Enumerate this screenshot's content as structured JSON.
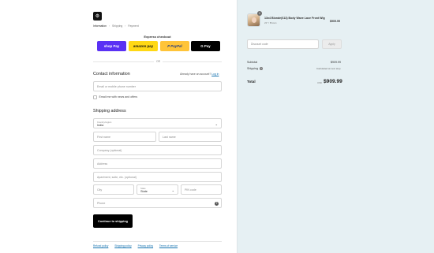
{
  "brand": {
    "logo_glyph": "⚙"
  },
  "breadcrumbs": [
    {
      "label": "Information",
      "active": true
    },
    {
      "label": "Shipping"
    },
    {
      "label": "Payment"
    }
  ],
  "express": {
    "title": "Express checkout",
    "buttons": [
      "shop Pay",
      "amazon pay",
      "P PayPal",
      "G Pay"
    ],
    "or": "OR"
  },
  "contact": {
    "title": "Contact information",
    "have_account": "Already have an account?",
    "login_link": "Log in",
    "email_placeholder": "Email or mobile phone number",
    "newsletter_label": "Email me with news and offers"
  },
  "shipping": {
    "title": "Shipping address",
    "country_label": "Country/region",
    "country_value": "India",
    "first_name": "First name",
    "last_name": "Last name",
    "company": "Company (optional)",
    "address": "Address",
    "apartment": "Apartment, suite, etc. (optional)",
    "city": "City",
    "state_label": "State",
    "state_value": "State",
    "pin": "PIN code",
    "phone": "Phone"
  },
  "continue_label": "Continue to shipping",
  "footer_links": [
    "Refund policy",
    "Shipping policy",
    "Privacy policy",
    "Terms of service"
  ],
  "summary": {
    "product": {
      "quantity": "1",
      "name": "13x4 Blonde(613) Body Wave Lace Front Wig",
      "variant": "22\" / Brown",
      "price": "$909.99"
    },
    "discount_placeholder": "Discount code",
    "apply_label": "Apply",
    "subtotal_label": "Subtotal",
    "subtotal_value": "$909.99",
    "shipping_label": "Shipping",
    "shipping_value": "Calculated at next step",
    "total_label": "Total",
    "currency": "USD",
    "total_value": "$909.99"
  },
  "colors": {
    "shop_pay": "#5a31f4",
    "amazon_pay": "#ffd814",
    "paypal": "#ffc439",
    "gpay": "#000000",
    "link": "#1773b0",
    "summary_bg": "#e6f0f3"
  }
}
